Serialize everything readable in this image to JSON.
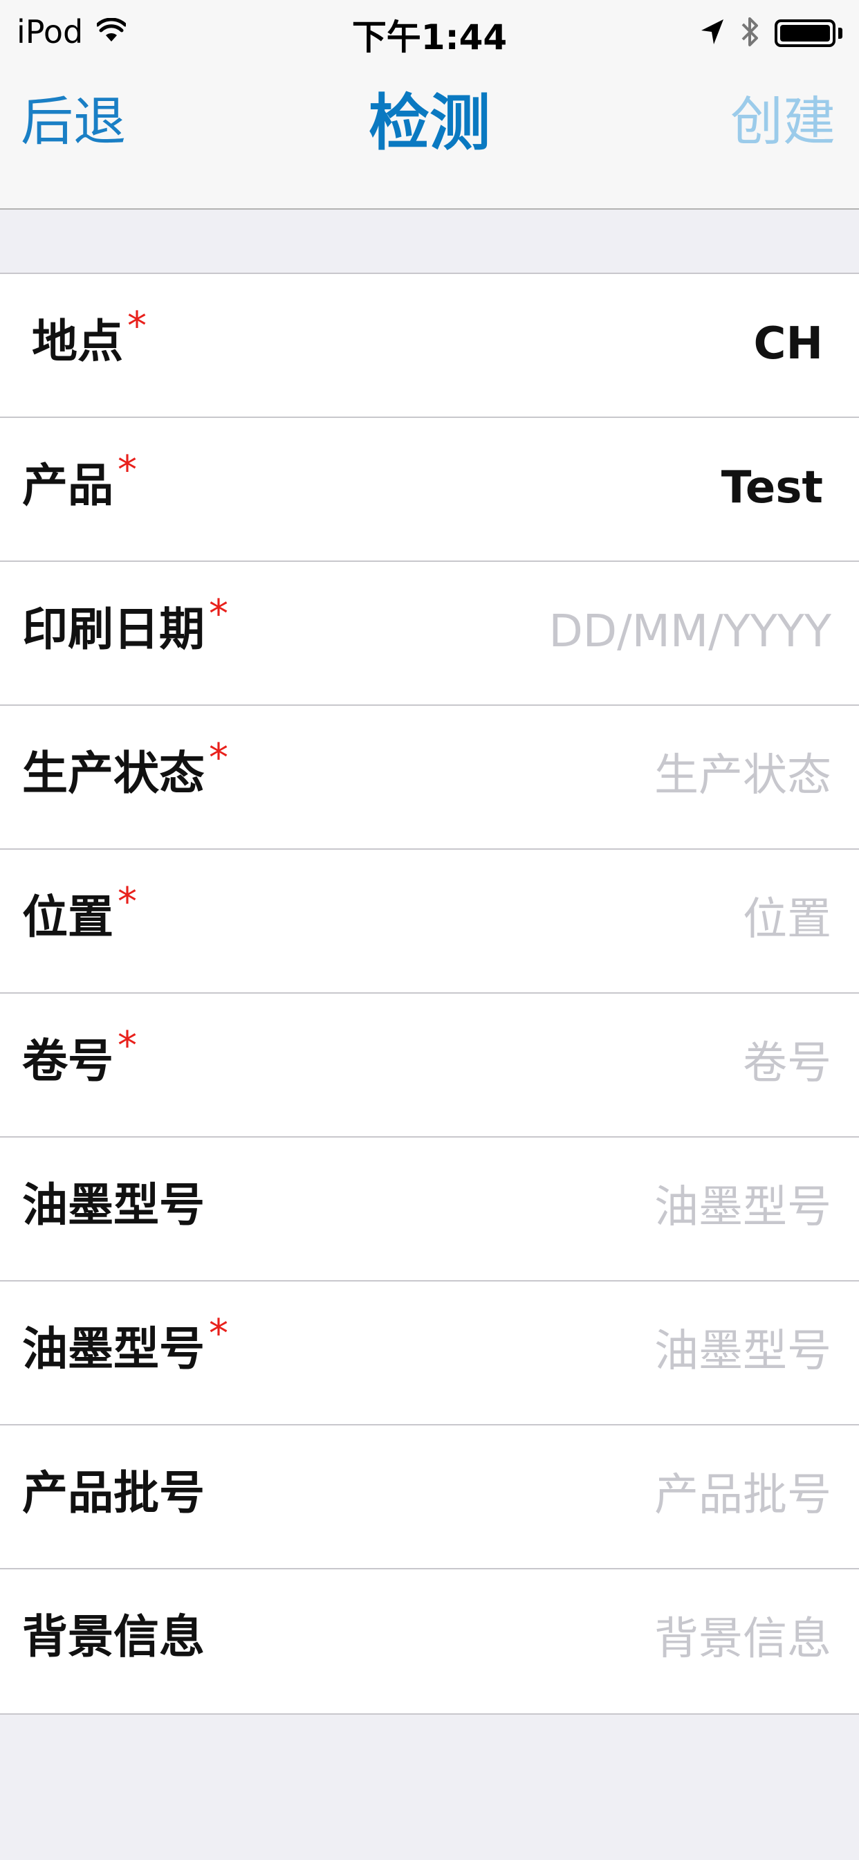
{
  "status_bar": {
    "carrier": "iPod",
    "time": "下午1:44",
    "icons": [
      "wifi-icon",
      "location-arrow-icon",
      "bluetooth-icon",
      "battery-icon"
    ]
  },
  "nav": {
    "back_label": "后退",
    "title": "检测",
    "create_label": "创建"
  },
  "colors": {
    "accent": "#0a79c1",
    "accent_disabled": "#9bcbea",
    "required": "#e8201b",
    "placeholder": "#c7c7cd",
    "background": "#efeff4"
  },
  "form": {
    "required_mark": "*",
    "rows": [
      {
        "label": "地点",
        "required": true,
        "value": "CH",
        "placeholder": ""
      },
      {
        "label": "产品",
        "required": true,
        "value": "Test",
        "placeholder": ""
      },
      {
        "label": "印刷日期",
        "required": true,
        "value": "",
        "placeholder": "DD/MM/YYYY"
      },
      {
        "label": "生产状态",
        "required": true,
        "value": "",
        "placeholder": "生产状态"
      },
      {
        "label": "位置",
        "required": true,
        "value": "",
        "placeholder": "位置"
      },
      {
        "label": "卷号",
        "required": true,
        "value": "",
        "placeholder": "卷号"
      },
      {
        "label": "油墨型号",
        "required": false,
        "value": "",
        "placeholder": "油墨型号"
      },
      {
        "label": "油墨型号",
        "required": true,
        "value": "",
        "placeholder": "油墨型号"
      },
      {
        "label": "产品批号",
        "required": false,
        "value": "",
        "placeholder": "产品批号"
      },
      {
        "label": "背景信息",
        "required": false,
        "value": "",
        "placeholder": "背景信息"
      }
    ]
  }
}
